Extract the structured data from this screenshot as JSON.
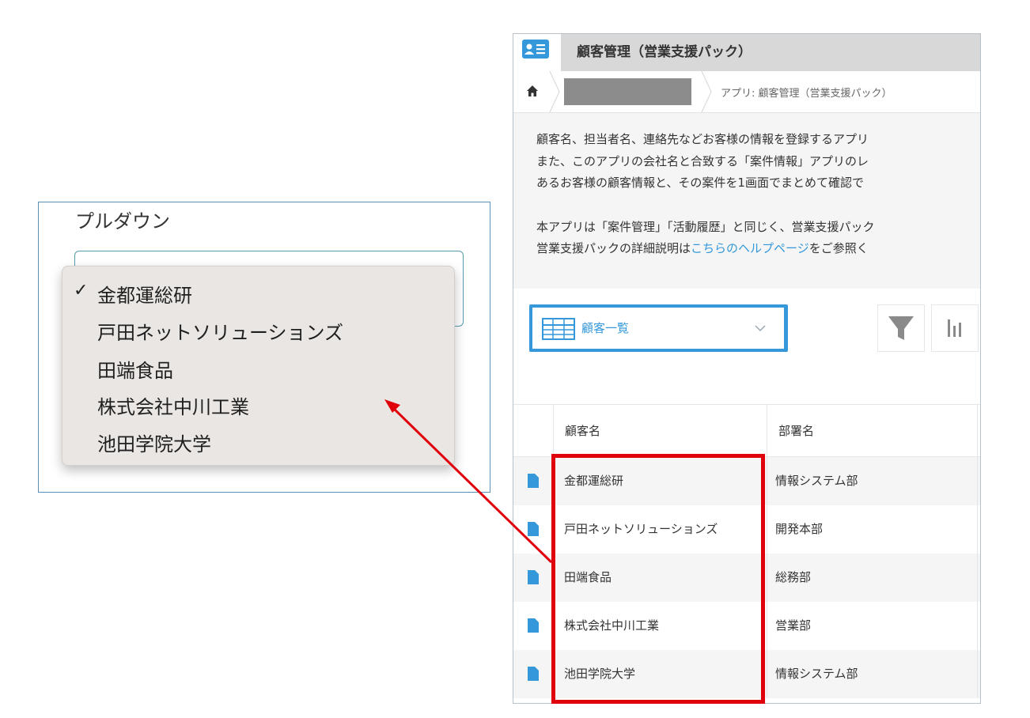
{
  "pulldown": {
    "title": "プルダウン",
    "checkmark": "✓",
    "options": [
      "金都運総研",
      "戸田ネットソリューションズ",
      "田端食品",
      "株式会社中川工業",
      "池田学院大学"
    ],
    "selected_index": 0
  },
  "app": {
    "title": "顧客管理（営業支援パック）",
    "breadcrumb": {
      "app_label": "アプリ: 顧客管理（営業支援パック）"
    },
    "description": {
      "line1": "顧客名、担当者名、連絡先などお客様の情報を登録するアプリ",
      "line2": "また、このアプリの会社名と合致する「案件情報」アプリのレ",
      "line3": "あるお客様の顧客情報と、その案件を1画面でまとめて確認で",
      "line4": "本アプリは「案件管理」「活動履歴」と同じく、営業支援パック",
      "line5_prefix": "営業支援パックの詳細説明は",
      "line5_link": "こちらのヘルプページ",
      "line5_suffix": "をご参照く"
    },
    "view_select": {
      "label": "顧客一覧"
    },
    "table": {
      "headers": [
        "顧客名",
        "部署名"
      ],
      "rows": [
        {
          "name": "金都運総研",
          "dept": "情報システム部"
        },
        {
          "name": "戸田ネットソリューションズ",
          "dept": "開発本部"
        },
        {
          "name": "田端食品",
          "dept": "総務部"
        },
        {
          "name": "株式会社中川工業",
          "dept": "営業部"
        },
        {
          "name": "池田学院大学",
          "dept": "情報システム部"
        }
      ]
    }
  },
  "colors": {
    "accent": "#3498db",
    "highlight": "#e0000b",
    "menu_bg": "#eae6e3"
  }
}
